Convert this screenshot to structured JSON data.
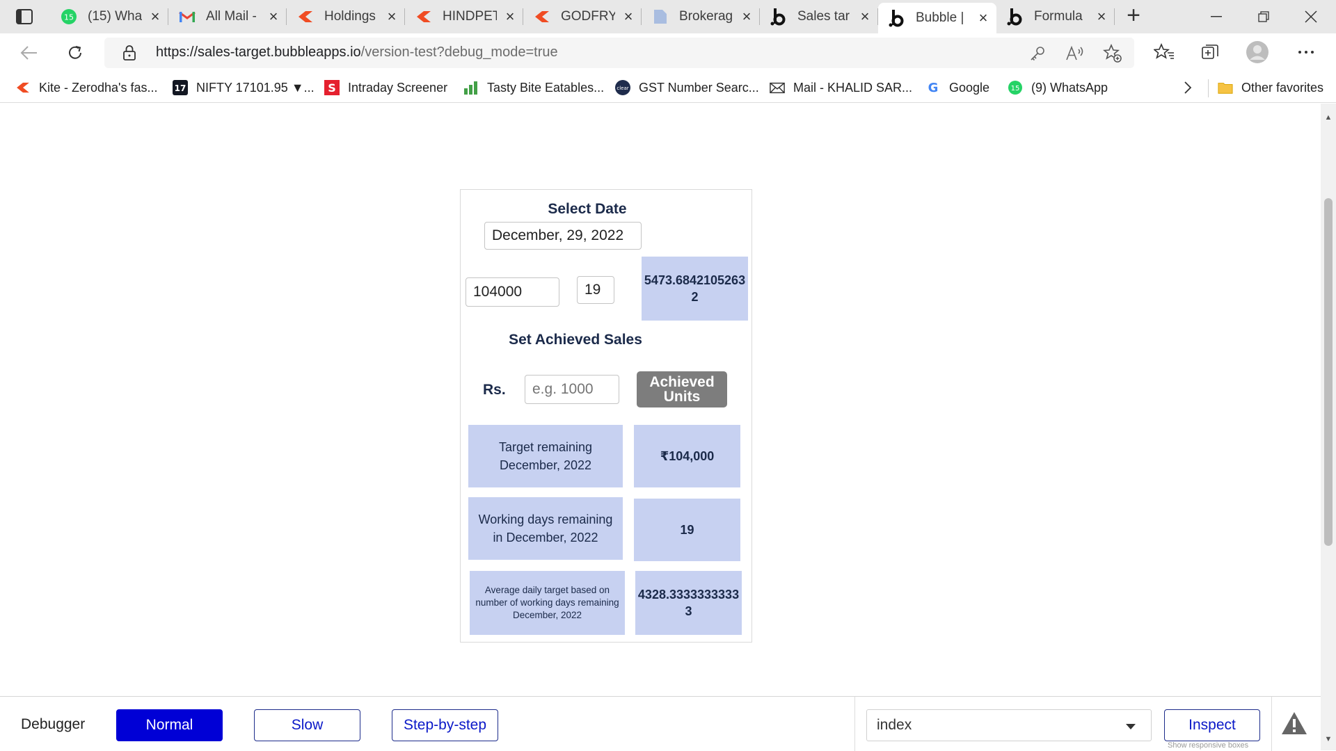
{
  "browser": {
    "tabs": [
      {
        "title": "(15) Wha",
        "icon": "whatsapp-icon",
        "badge": "15"
      },
      {
        "title": "All Mail -",
        "icon": "gmail-icon"
      },
      {
        "title": "Holdings",
        "icon": "kite-icon"
      },
      {
        "title": "HINDPET",
        "icon": "kite-icon"
      },
      {
        "title": "GODFRY",
        "icon": "kite-icon"
      },
      {
        "title": "Brokerag",
        "icon": "document-icon"
      },
      {
        "title": "Sales tar",
        "icon": "bubble-icon"
      },
      {
        "title": "Bubble |",
        "icon": "bubble-icon",
        "active": true
      },
      {
        "title": "Formula",
        "icon": "bubble-icon"
      }
    ],
    "url": {
      "host": "https://sales-target.bubbleapps.io",
      "path": "/version-test?debug_mode=true"
    },
    "bookmarks": [
      {
        "label": "Kite - Zerodha's fas...",
        "icon": "kite-icon"
      },
      {
        "label": "NIFTY 17101.95 ▼...",
        "icon": "tradingview-icon"
      },
      {
        "label": "Intraday Screener",
        "icon": "screener-icon"
      },
      {
        "label": "Tasty Bite Eatables...",
        "icon": "bar-chart-icon"
      },
      {
        "label": "GST Number Searc...",
        "icon": "clear-icon"
      },
      {
        "label": "Mail - KHALID SAR...",
        "icon": "mail-icon"
      },
      {
        "label": "Google",
        "icon": "google-icon"
      },
      {
        "label": "(9) WhatsApp",
        "icon": "whatsapp-icon",
        "badge": "15"
      }
    ],
    "other_favorites": "Other favorites"
  },
  "app": {
    "select_date_label": "Select Date",
    "date_value": "December, 29, 2022",
    "target_value": "104000",
    "days_value": "19",
    "daily_result": "5473.6842105263\n2",
    "set_achieved_label": "Set Achieved Sales",
    "rs_label": "Rs.",
    "achieved_placeholder": "e.g. 1000",
    "achieved_units_button": "Achieved\nUnits",
    "rows": [
      {
        "label": "Target remaining\nDecember, 2022",
        "value": "₹104,000"
      },
      {
        "label": "Working days remaining\nin December, 2022",
        "value": "19"
      },
      {
        "label": "Average daily target based on\nnumber of working days remaining\nDecember, 2022",
        "value": "4328.3333333333\n3"
      }
    ]
  },
  "debugger": {
    "label": "Debugger",
    "modes": [
      "Normal",
      "Slow",
      "Step-by-step"
    ],
    "active_mode": "Normal",
    "page_select": "index",
    "inspect_label": "Inspect",
    "hint": "Show responsive boxes"
  },
  "colors": {
    "accent_blue": "#0000d6",
    "cell_blue": "#c7d1f1",
    "button_gray": "#7d7d7d"
  }
}
